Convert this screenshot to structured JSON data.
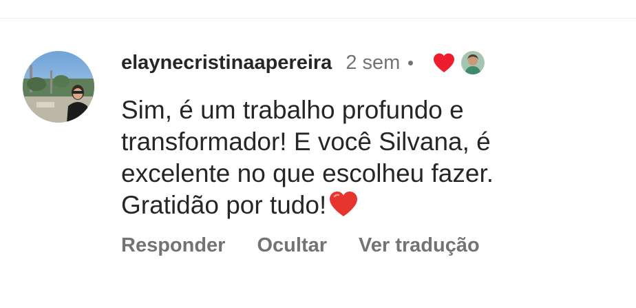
{
  "comment": {
    "username": "elaynecristinaapereira",
    "time": "2 sem",
    "text": "Sim, é um trabalho profundo e transformador! E você Silvana, é excelente no que escolheu fazer. Gratidão por tudo!",
    "liked_by_author": true
  },
  "actions": {
    "reply": "Responder",
    "hide": "Ocultar",
    "translate": "Ver tradução"
  },
  "colors": {
    "text": "#262626",
    "secondary": "#737373",
    "heart": "#ed1c2e"
  },
  "icons": {
    "reaction": "heart-icon",
    "inline_emoji": "heart-emoji"
  }
}
